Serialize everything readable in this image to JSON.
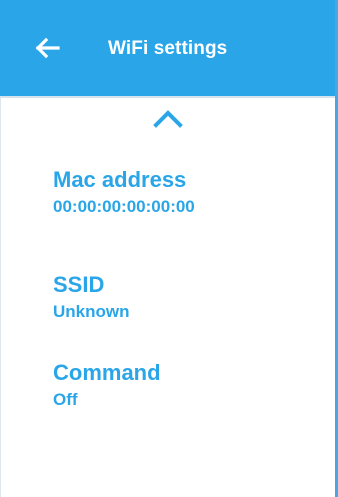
{
  "header": {
    "title": "WiFi settings",
    "back_icon": "arrow-left-icon",
    "background_color": "#2aa6e8"
  },
  "collapse_icon": "chevron-up-icon",
  "info": {
    "mac": {
      "label": "Mac address",
      "value": "00:00:00:00:00:00"
    },
    "ssid": {
      "label": "SSID",
      "value": "Unknown"
    },
    "command": {
      "label": "Command",
      "value": "Off"
    }
  },
  "colors": {
    "accent": "#2aa6e8",
    "text_on_accent": "#ffffff",
    "background": "#ffffff"
  }
}
